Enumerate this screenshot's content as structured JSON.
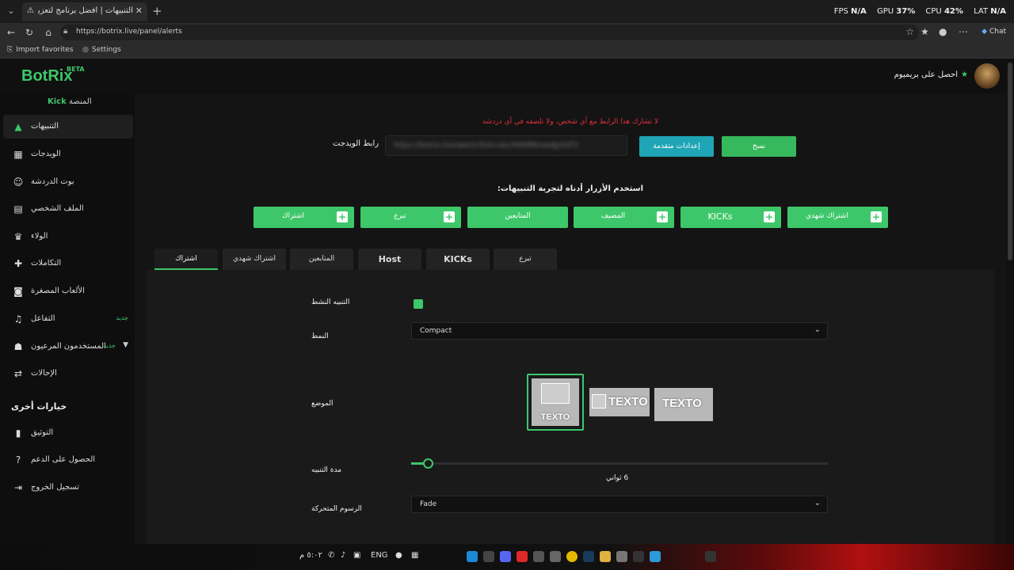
{
  "browser": {
    "tab_title": "التنبيهات | أفضل برنامج لتعزيز البث ا...",
    "perf": {
      "fps_label": "FPS",
      "fps": "N/A",
      "gpu_label": "GPU",
      "gpu": "37%",
      "cpu_label": "CPU",
      "cpu": "42%",
      "lat_label": "LAT",
      "lat": "N/A"
    },
    "url": "https://botrix.live/panel/alerts",
    "chat_label": "Chat",
    "favorites": [
      {
        "label": "Import favorites"
      },
      {
        "label": "Settings"
      }
    ]
  },
  "header": {
    "logo": "BotRix",
    "beta": "BETA",
    "premium": "احصل على بريميوم"
  },
  "sidebar": {
    "platform_label": "المنصة",
    "platform_value": "Kick",
    "items": [
      {
        "label": "التنبيهات",
        "icon": "warning-icon"
      },
      {
        "label": "الويدجات",
        "icon": "grid-icon"
      },
      {
        "label": "بوت الدردشة",
        "icon": "robot-icon"
      },
      {
        "label": "الملف الشخصي",
        "icon": "profile-card-icon"
      },
      {
        "label": "الولاء",
        "icon": "trophy-icon"
      },
      {
        "label": "التكاملات",
        "icon": "puzzle-icon"
      },
      {
        "label": "الألعاب المصغرة",
        "icon": "gamepad-icon"
      },
      {
        "label": "التفاعل",
        "icon": "music-icon",
        "badge": "جديد"
      },
      {
        "label": "المستخدمون المرعيون",
        "icon": "users-icon",
        "badge": "جديد"
      },
      {
        "label": "الإحالات",
        "icon": "link-icon"
      }
    ],
    "other_section": "خيارات أخرى",
    "other_items": [
      {
        "label": "التوثيق",
        "icon": "book-icon"
      },
      {
        "label": "الحصول على الدعم",
        "icon": "help-icon"
      },
      {
        "label": "تسجيل الخروج",
        "icon": "logout-icon"
      }
    ]
  },
  "main": {
    "warning": "لا تشارك هذا الرابط مع أي شخص، ولا تلصقه في أي دردشة",
    "widget_label": "رابط الويدجت",
    "widget_url": "https://botrix.live/alerts?bid=abcXK8MNmw4Jp5dT2",
    "advanced_button": "إعدادات متقدمة",
    "copy_button": "نسخ",
    "test_hint": "استخدم الأزرار أدناه لتجربة التنبيهات:",
    "test_buttons": [
      {
        "label": "اشتراك"
      },
      {
        "label": "تبرع"
      },
      {
        "label": "المتابعين"
      },
      {
        "label": "المضيف"
      },
      {
        "label": "KICKs"
      },
      {
        "label": "اشتراك شهدي"
      }
    ],
    "alert_tabs": [
      {
        "label": "اشتراك"
      },
      {
        "label": "اشتراك شهدي"
      },
      {
        "label": "المتابعين"
      },
      {
        "label": "Host"
      },
      {
        "label": "KICKs"
      },
      {
        "label": "تبرع"
      }
    ],
    "form": {
      "active_label": "التنبيه النشط",
      "active_value": true,
      "style_label": "النمط",
      "style_value": "Compact",
      "position_label": "الموضع",
      "position_text": "TEXTO",
      "duration_label": "مدة التنبيه",
      "duration_value": "6 ثواني",
      "duration_fraction": 0.04,
      "animation_label": "الرسوم المتحركة",
      "animation_value": "Fade"
    }
  },
  "taskbar": {
    "lang": "ENG",
    "time": "٥:٠٢ م"
  },
  "colors": {
    "accent": "#3ec76a",
    "info": "#1fa5b5",
    "danger": "#e0303a"
  }
}
